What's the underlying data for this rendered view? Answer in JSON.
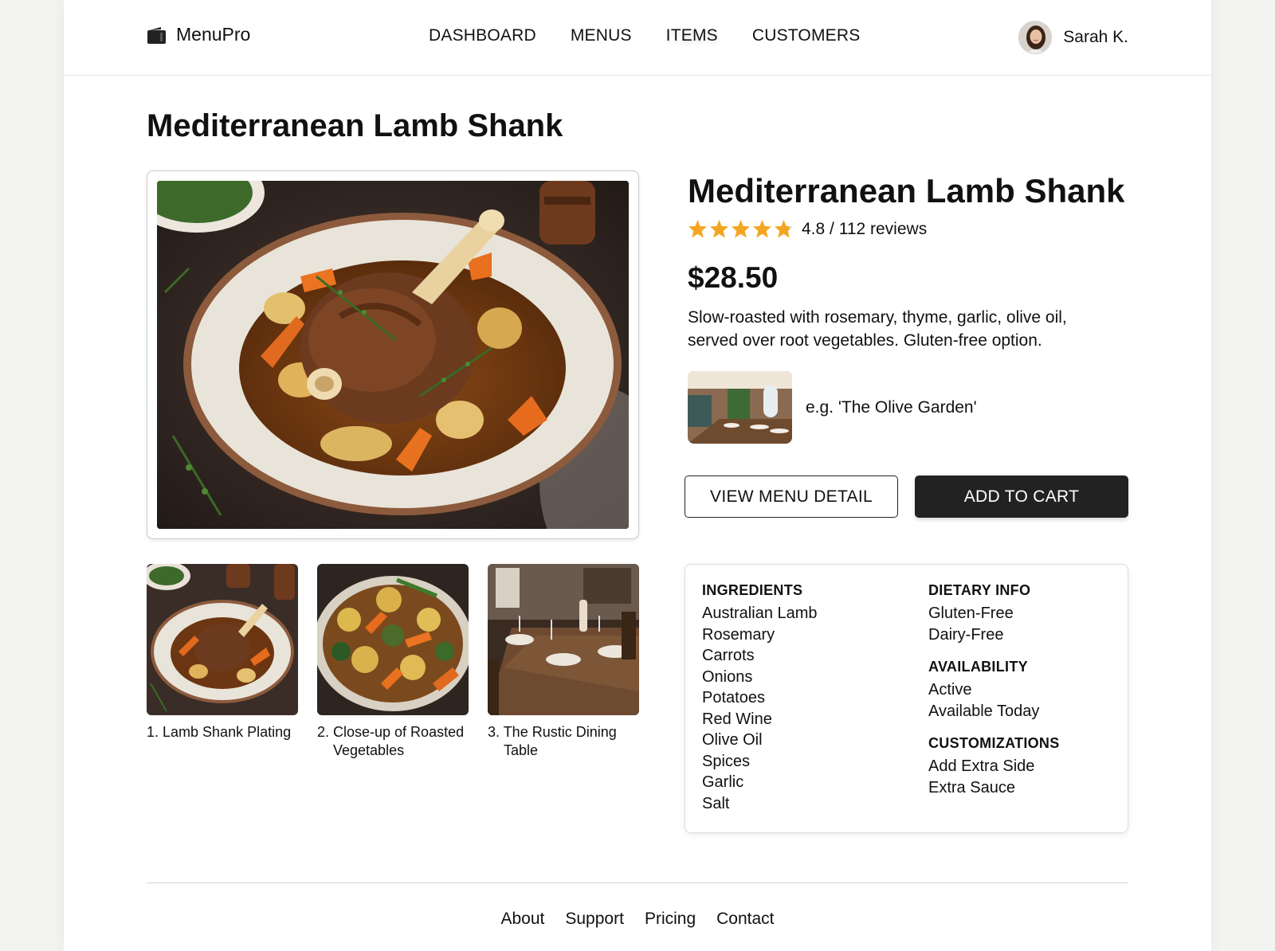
{
  "header": {
    "brand": "MenuPro",
    "nav": [
      "DASHBOARD",
      "MENUS",
      "ITEMS",
      "CUSTOMERS"
    ],
    "user_name": "Sarah K."
  },
  "page_title": "Mediterranean Lamb Shank",
  "item": {
    "title": "Mediterranean Lamb Shank",
    "rating_value": 4.8,
    "rating_text": "4.8 / 112 reviews",
    "price": "$28.50",
    "description": "Slow-roasted with rosemary, thyme, garlic, olive oil, served over root vegetables. Gluten-free option.",
    "restaurant": "e.g. 'The Olive Garden'"
  },
  "gallery": [
    {
      "caption": "1. Lamb Shank Plating"
    },
    {
      "caption": "2. Close-up of Roasted Vegetables"
    },
    {
      "caption": "3. The Rustic Dining Table"
    }
  ],
  "buttons": {
    "view_menu": "VIEW MENU DETAIL",
    "add_to_cart": "ADD TO CART"
  },
  "info": {
    "ingredients_heading": "INGREDIENTS",
    "ingredients": [
      "Australian Lamb",
      "Rosemary",
      "Carrots",
      "Onions",
      "Potatoes",
      "Red Wine",
      "Olive Oil",
      "Spices",
      "Garlic",
      "Salt"
    ],
    "dietary_heading": "DIETARY INFO",
    "dietary": [
      "Gluten-Free",
      "Dairy-Free"
    ],
    "availability_heading": "AVAILABILITY",
    "availability": [
      "Active",
      "Available Today"
    ],
    "customizations_heading": "CUSTOMIZATIONS",
    "customizations": [
      "Add Extra Side",
      "Extra Sauce"
    ]
  },
  "footer": [
    "About",
    "Support",
    "Pricing",
    "Contact"
  ],
  "colors": {
    "star": "#f4a623",
    "dark_button": "#222222",
    "border": "#d7d7d7"
  }
}
